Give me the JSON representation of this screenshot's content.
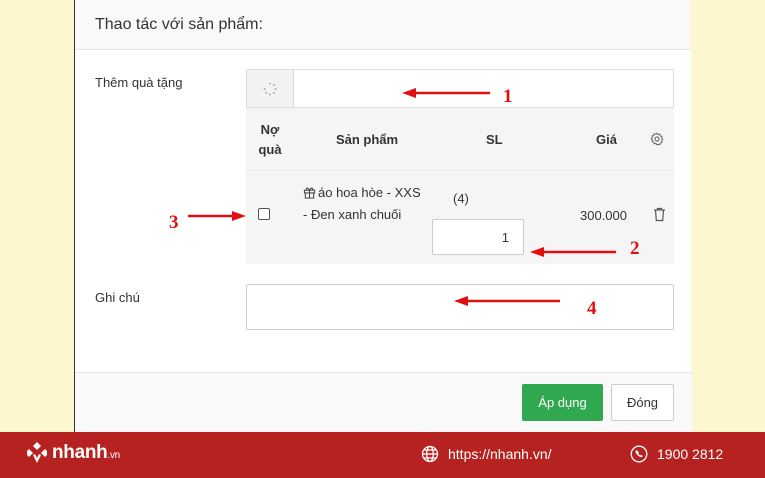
{
  "modal": {
    "title": "Thao tác với sản phẩm:",
    "gift_label": "Thêm quà tặng",
    "note_label": "Ghi chú",
    "search": {
      "value": "",
      "icon": "spinner-icon"
    },
    "table": {
      "headers": {
        "no_line1": "Nợ",
        "no_line2": "quà",
        "product": "Sản phẩm",
        "qty": "SL",
        "price": "Giá"
      },
      "rows": [
        {
          "checked": false,
          "product": "áo hoa hòe - XXS - Đen xanh chuối",
          "stock": "(4)",
          "qty": "1",
          "price": "300.000"
        }
      ]
    },
    "note": {
      "value": ""
    },
    "apply_label": "Áp dụng",
    "close_label": "Đóng"
  },
  "annotations": {
    "color": "#e01010",
    "labels": [
      "1",
      "2",
      "3",
      "4"
    ]
  },
  "footer": {
    "brand": "nhanh",
    "brand_suffix": ".vn",
    "website": "https://nhanh.vn/",
    "phone": "1900 2812",
    "background": "#b5221f"
  }
}
